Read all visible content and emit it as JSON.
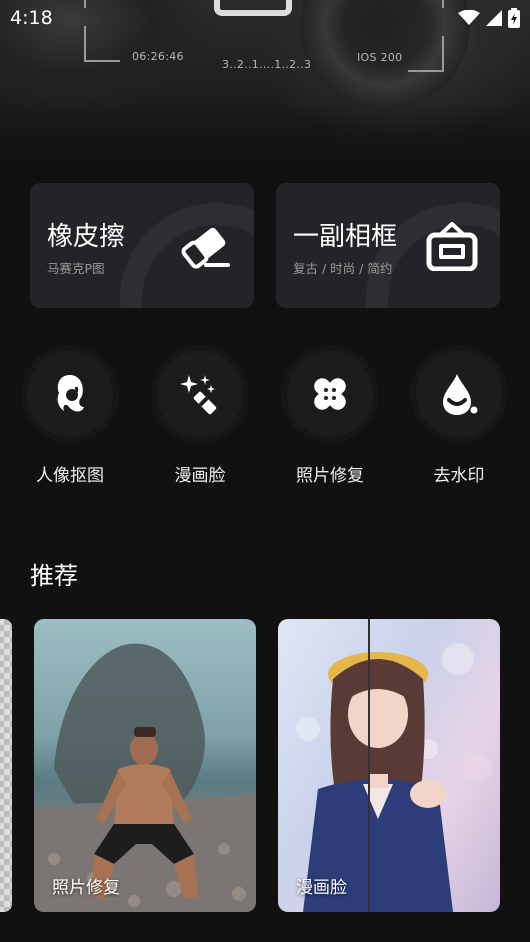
{
  "status_bar": {
    "time": "4:18"
  },
  "hero": {
    "hud_left": "06:26:46",
    "hud_center": "3..2..1....1..2..3",
    "hud_right": "IOS 200"
  },
  "cards": [
    {
      "title": "橡皮擦",
      "subtitle": "马赛克P图",
      "icon": "eraser-icon"
    },
    {
      "title": "一副相框",
      "subtitle": "复古 / 时尚 / 简约",
      "icon": "photo-frame-icon"
    }
  ],
  "tools": [
    {
      "label": "人像抠图",
      "icon": "portrait-cutout-icon"
    },
    {
      "label": "漫画脸",
      "icon": "sparkle-wand-icon"
    },
    {
      "label": "照片修复",
      "icon": "bandage-icon"
    },
    {
      "label": "去水印",
      "icon": "water-drop-icon"
    }
  ],
  "recommend": {
    "title": "推荐",
    "items": [
      {
        "label": "照片修复"
      },
      {
        "label": "漫画脸"
      }
    ]
  },
  "colors": {
    "background": "#111111",
    "card": "#242428",
    "tool_circle": "#1c1c1e"
  }
}
